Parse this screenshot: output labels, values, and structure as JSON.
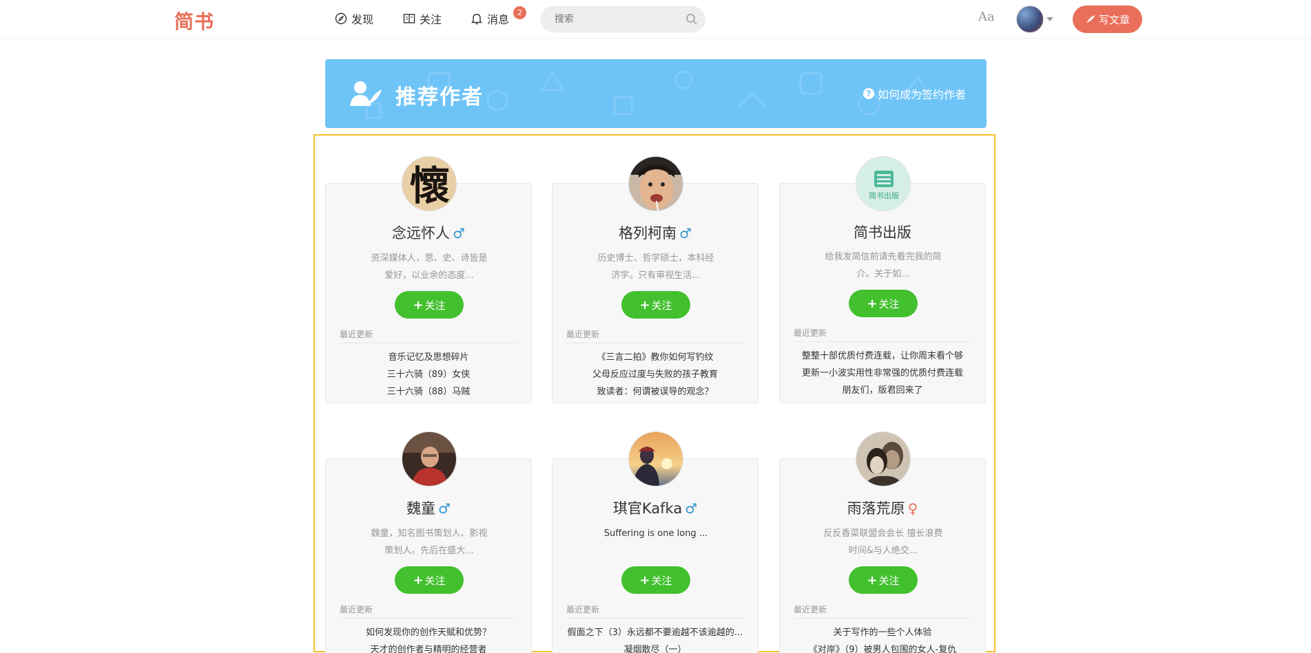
{
  "nav": {
    "logo": "简书",
    "discover": "发现",
    "follow": "关注",
    "messages": "消息",
    "messages_badge": "2",
    "search_placeholder": "搜索",
    "aa": "Aa",
    "write": "写文章"
  },
  "banner": {
    "title": "推荐作者",
    "link": "如何成为签约作者",
    "color": "#6fc4f7"
  },
  "recent_label": "最近更新",
  "follow_label": "关注",
  "authors": [
    {
      "name": "念远怀人",
      "gender": "♂",
      "desc1": "资深媒体人，思、史、诗皆是",
      "desc2": "爱好，以业余的态度...",
      "articles": [
        "音乐记忆及思想碎片",
        "三十六骑（89）女侠",
        "三十六骑（88）马贼"
      ]
    },
    {
      "name": "格列柯南",
      "gender": "♂",
      "desc1": "历史博士、哲学硕士，本科经",
      "desc2": "济学。只有审视生活...",
      "articles": [
        "《三言二拍》教你如何写钓纹",
        "父母反应过度与失败的孩子教育",
        "致读者：何谓被误导的观念？"
      ]
    },
    {
      "name": "简书出版",
      "gender": "",
      "desc1": "给我发简信前请先看完我的简",
      "desc2": "介。关于如...",
      "articles": [
        "整整十部优质付费连载，让你周末看个够",
        "更新一小波实用性非常强的优质付费连载",
        "朋友们，版君回来了"
      ]
    },
    {
      "name": "魏童",
      "gender": "♂",
      "desc1": "魏童，知名图书策划人、影视",
      "desc2": "策划人。先后在盛大...",
      "articles": [
        "如何发现你的创作天赋和优势？",
        "天才的创作者与精明的经营者"
      ]
    },
    {
      "name": "琪官Kafka",
      "gender": "♂",
      "desc1": "Suffering is one long ...",
      "desc2": "",
      "articles": [
        "假面之下（3）永远都不要逾越不该逾越的...",
        "凝烟散尽（一）"
      ]
    },
    {
      "name": "雨落荒原",
      "gender": "♀",
      "desc1": "反反香菜联盟会会长 擅长浪费",
      "desc2": "时间&与人绝交...",
      "articles": [
        "关于写作的一些个人体验",
        "《对岸》（9）被男人包围的女人-复仇"
      ]
    }
  ]
}
